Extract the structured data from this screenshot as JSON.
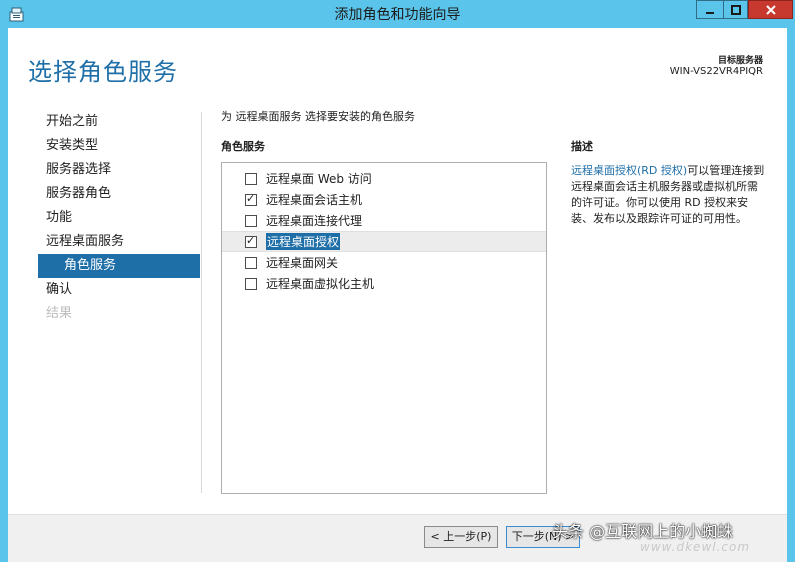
{
  "window": {
    "title": "添加角色和功能向导",
    "icon": "server-manager-icon",
    "close_color": "#c7392e",
    "frame_color": "#5bc4ea"
  },
  "header": {
    "page_title": "选择角色服务",
    "target_server_label": "目标服务器",
    "target_server_value": "WIN-VS22VR4PIQR"
  },
  "nav": {
    "items": [
      {
        "label": "开始之前",
        "state": "normal"
      },
      {
        "label": "安装类型",
        "state": "normal"
      },
      {
        "label": "服务器选择",
        "state": "normal"
      },
      {
        "label": "服务器角色",
        "state": "normal"
      },
      {
        "label": "功能",
        "state": "normal"
      },
      {
        "label": "远程桌面服务",
        "state": "normal"
      },
      {
        "label": "角色服务",
        "state": "active"
      },
      {
        "label": "确认",
        "state": "normal"
      },
      {
        "label": "结果",
        "state": "disabled"
      }
    ]
  },
  "main": {
    "instruction": "为 远程桌面服务 选择要安装的角色服务",
    "roles_heading": "角色服务",
    "roles": [
      {
        "label": "远程桌面 Web 访问",
        "checked": false
      },
      {
        "label": "远程桌面会话主机",
        "checked": true
      },
      {
        "label": "远程桌面连接代理",
        "checked": false
      },
      {
        "label": "远程桌面授权",
        "checked": true,
        "selected": true
      },
      {
        "label": "远程桌面网关",
        "checked": false
      },
      {
        "label": "远程桌面虚拟化主机",
        "checked": false
      }
    ],
    "description_heading": "描述",
    "description_link": "远程桌面授权(RD 授权)",
    "description_text": "可以管理连接到远程桌面会话主机服务器或虚拟机所需的许可证。你可以使用 RD 授权来安装、发布以及跟踪许可证的可用性。"
  },
  "footer": {
    "prev_label": "< 上一步(P)",
    "next_label": "下一步(N) >"
  },
  "overlay": {
    "watermark": "头条 @互联网上的小蜘蛛",
    "url": "www.dkewl.com"
  },
  "colors": {
    "accent": "#1e6ea7",
    "title": "#1f6fa8"
  }
}
